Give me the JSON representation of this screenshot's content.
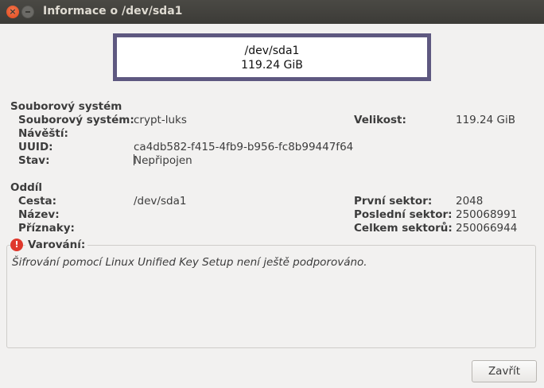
{
  "window": {
    "title": "Informace o /dev/sda1"
  },
  "device": {
    "name": "/dev/sda1",
    "size": "119.24 GiB"
  },
  "filesystem": {
    "section_title": "Souborový systém",
    "type_label": "Souborový systém:",
    "type_value": "crypt-luks",
    "label_label": "Návěští:",
    "label_value": "",
    "uuid_label": "UUID:",
    "uuid_value": "ca4db582-f415-4fb9-b956-fc8b99447f64",
    "state_label": "Stav:",
    "state_value": "Nepřipojen",
    "size_label": "Velikost:",
    "size_value": "119.24 GiB"
  },
  "partition": {
    "section_title": "Oddíl",
    "path_label": "Cesta:",
    "path_value": "/dev/sda1",
    "name_label": "Název:",
    "name_value": "",
    "flags_label": "Příznaky:",
    "flags_value": "",
    "first_sector_label": "První sektor:",
    "first_sector_value": "2048",
    "last_sector_label": "Poslední sektor:",
    "last_sector_value": "250068991",
    "total_sectors_label": "Celkem sektorů:",
    "total_sectors_value": "250066944"
  },
  "warning": {
    "title": "Varování:",
    "message": "Šifrování pomocí Linux Unified Key Setup není ještě podporováno.",
    "icon": "error-icon",
    "icon_color": "#df382c"
  },
  "buttons": {
    "close": "Zavřít"
  },
  "colors": {
    "device_border": "#5e5880",
    "titlebar": "#3c3b37",
    "close_button": "#e0461a"
  }
}
